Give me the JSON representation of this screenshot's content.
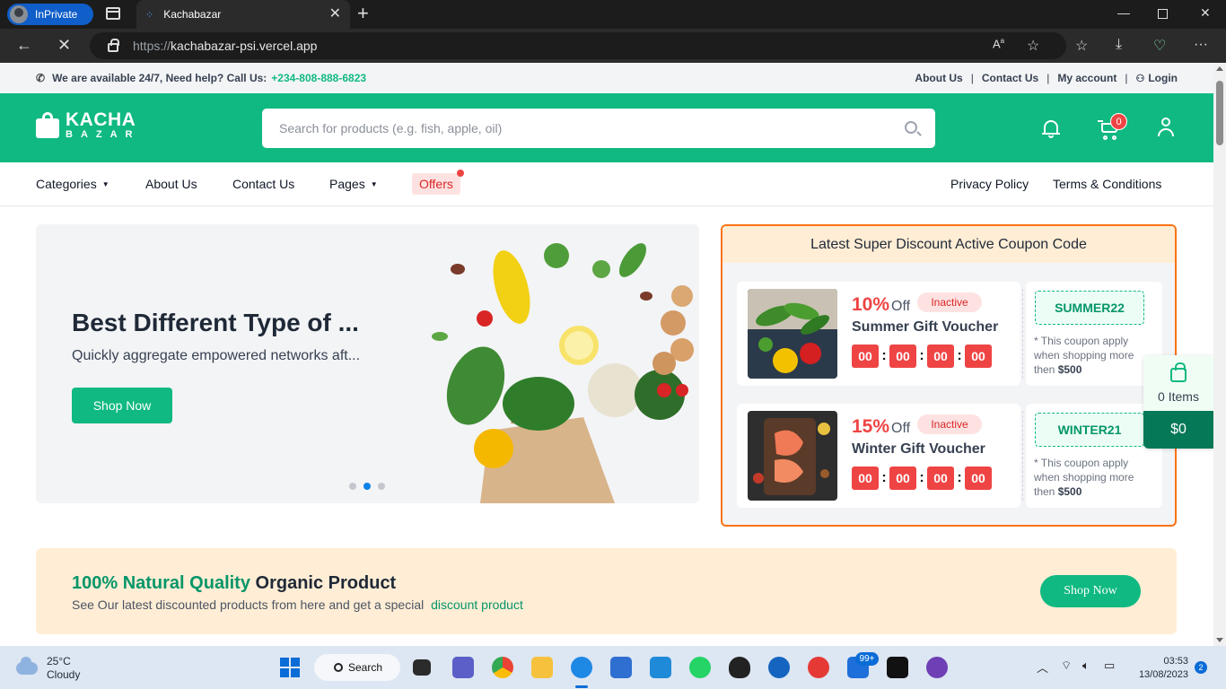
{
  "browser": {
    "inprivate_label": "InPrivate",
    "tab_title": "Kachabazar",
    "url_scheme": "https://",
    "url_host": "kachabazar-psi.vercel.app"
  },
  "topbar": {
    "help_text": "We are available 24/7, Need help? Call Us:",
    "phone": "+234-808-888-6823",
    "links": [
      "About Us",
      "Contact Us",
      "My account",
      "Login"
    ]
  },
  "header": {
    "logo_line1": "KACHA",
    "logo_line2": "BAZAR",
    "search_placeholder": "Search for products (e.g. fish, apple, oil)",
    "cart_count": "0"
  },
  "nav": {
    "categories": "Categories",
    "about": "About Us",
    "contact": "Contact Us",
    "pages": "Pages",
    "offers": "Offers",
    "privacy": "Privacy Policy",
    "terms": "Terms & Conditions"
  },
  "hero": {
    "title": "Best Different Type of ...",
    "subtitle": "Quickly aggregate empowered networks aft...",
    "button": "Shop Now",
    "active_slide": 2,
    "slide_count": 3
  },
  "coupons": {
    "heading": "Latest Super Discount Active Coupon Code",
    "items": [
      {
        "percent": "10%",
        "off": "Off",
        "status": "Inactive",
        "name": "Summer Gift Voucher",
        "timer": [
          "00",
          "00",
          "00",
          "00"
        ],
        "code": "SUMMER22",
        "note": "* This coupon apply when shopping more then",
        "min": "$500"
      },
      {
        "percent": "15%",
        "off": "Off",
        "status": "Inactive",
        "name": "Winter Gift Voucher",
        "timer": [
          "00",
          "00",
          "00",
          "00"
        ],
        "code": "WINTER21",
        "note": "* This coupon apply when shopping more then",
        "min": "$500"
      }
    ]
  },
  "float_cart": {
    "items": "0 Items",
    "total": "$0"
  },
  "promo": {
    "title_highlight": "100% Natural Quality",
    "title_rest": "Organic Product",
    "text": "See Our latest discounted products from here and get a special",
    "link": "discount product",
    "button": "Shop Now"
  },
  "taskbar": {
    "temp": "25°C",
    "weather": "Cloudy",
    "search": "Search",
    "badge": "99+",
    "time": "03:53",
    "date": "13/08/2023",
    "notifications": "2"
  },
  "colors": {
    "brand_green": "#10b981",
    "accent_red": "#ef4444",
    "coupon_border": "#f97316"
  }
}
